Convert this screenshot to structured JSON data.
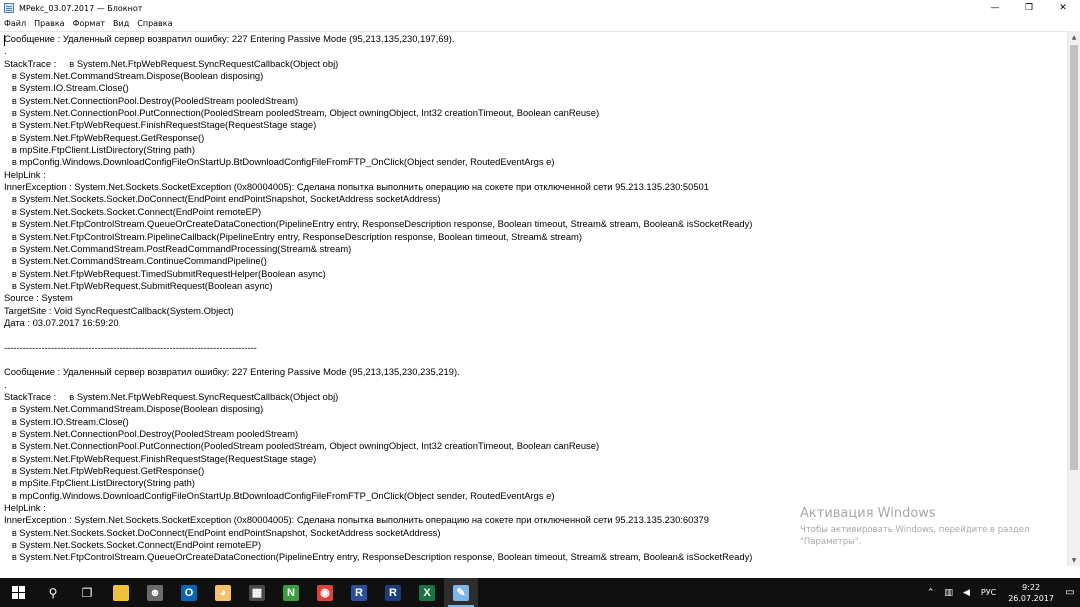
{
  "window": {
    "title": "MPekc_03.07.2017 — Блокнот",
    "minimize_glyph": "—",
    "maximize_glyph": "❐",
    "close_glyph": "✕"
  },
  "menu": {
    "items": [
      "Файл",
      "Правка",
      "Формат",
      "Вид",
      "Справка"
    ]
  },
  "document": {
    "lines": [
      "Сообщение : Удаленный сервер возвратил ошибку: 227 Entering Passive Mode (95,213,135,230,197,69).",
      ".",
      "StackTrace :     в System.Net.FtpWebRequest.SyncRequestCallback(Object obj)",
      "   в System.Net.CommandStream.Dispose(Boolean disposing)",
      "   в System.IO.Stream.Close()",
      "   в System.Net.ConnectionPool.Destroy(PooledStream pooledStream)",
      "   в System.Net.ConnectionPool.PutConnection(PooledStream pooledStream, Object owningObject, Int32 creationTimeout, Boolean canReuse)",
      "   в System.Net.FtpWebRequest.FinishRequestStage(RequestStage stage)",
      "   в System.Net.FtpWebRequest.GetResponse()",
      "   в mpSite.FtpClient.ListDirectory(String path)",
      "   в mpConfig.Windows.DownloadConfigFileOnStartUp.BtDownloadConfigFileFromFTP_OnClick(Object sender, RoutedEventArgs e)",
      "HelpLink :",
      "InnerException : System.Net.Sockets.SocketException (0x80004005): Сделана попытка выполнить операцию на сокете при отключенной сети 95.213.135.230:50501",
      "   в System.Net.Sockets.Socket.DoConnect(EndPoint endPointSnapshot, SocketAddress socketAddress)",
      "   в System.Net.Sockets.Socket.Connect(EndPoint remoteEP)",
      "   в System.Net.FtpControlStream.QueueOrCreateDataConection(PipelineEntry entry, ResponseDescription response, Boolean timeout, Stream& stream, Boolean& isSocketReady)",
      "   в System.Net.FtpControlStream.PipelineCallback(PipelineEntry entry, ResponseDescription response, Boolean timeout, Stream& stream)",
      "   в System.Net.CommandStream.PostReadCommandProcessing(Stream& stream)",
      "   в System.Net.CommandStream.ContinueCommandPipeline()",
      "   в System.Net.FtpWebRequest.TimedSubmitRequestHelper(Boolean async)",
      "   в System.Net.FtpWebRequest.SubmitRequest(Boolean async)",
      "Source : System",
      "TargetSite : Void SyncRequestCallback(System.Object)",
      "Дата : 03.07.2017 16:59:20",
      "",
      "---------------------------------------------------------------------------------",
      "",
      "Сообщение : Удаленный сервер возвратил ошибку: 227 Entering Passive Mode (95,213,135,230,235,219).",
      ".",
      "StackTrace :     в System.Net.FtpWebRequest.SyncRequestCallback(Object obj)",
      "   в System.Net.CommandStream.Dispose(Boolean disposing)",
      "   в System.IO.Stream.Close()",
      "   в System.Net.ConnectionPool.Destroy(PooledStream pooledStream)",
      "   в System.Net.ConnectionPool.PutConnection(PooledStream pooledStream, Object owningObject, Int32 creationTimeout, Boolean canReuse)",
      "   в System.Net.FtpWebRequest.FinishRequestStage(RequestStage stage)",
      "   в System.Net.FtpWebRequest.GetResponse()",
      "   в mpSite.FtpClient.ListDirectory(String path)",
      "   в mpConfig.Windows.DownloadConfigFileOnStartUp.BtDownloadConfigFileFromFTP_OnClick(Object sender, RoutedEventArgs e)",
      "HelpLink :",
      "InnerException : System.Net.Sockets.SocketException (0x80004005): Сделана попытка выполнить операцию на сокете при отключенной сети 95.213.135.230:60379",
      "   в System.Net.Sockets.Socket.DoConnect(EndPoint endPointSnapshot, SocketAddress socketAddress)",
      "   в System.Net.Sockets.Socket.Connect(EndPoint remoteEP)",
      "   в System.Net.FtpControlStream.QueueOrCreateDataConection(PipelineEntry entry, ResponseDescription response, Boolean timeout, Stream& stream, Boolean& isSocketReady)"
    ]
  },
  "scrollbar": {
    "up_glyph": "▲",
    "down_glyph": "▼"
  },
  "activation_watermark": {
    "title": "Активация Windows",
    "line1": "Чтобы активировать Windows, перейдите в раздел",
    "line2": "\"Параметры\"."
  },
  "taskbar": {
    "search_glyph": "⚲",
    "task_view_glyph": "❐",
    "apps": [
      {
        "name": "file-explorer-icon",
        "glyph": "",
        "color": "#f0c23b"
      },
      {
        "name": "people-icon",
        "glyph": "☻",
        "color": "#6b6b6b"
      },
      {
        "name": "outlook-icon",
        "glyph": "O",
        "color": "#0a64b4"
      },
      {
        "name": "paint-icon",
        "glyph": "◕",
        "color": "#f5c26b"
      },
      {
        "name": "calculator-icon",
        "glyph": "▦",
        "color": "#4b4b4b"
      },
      {
        "name": "notepad-plus-icon",
        "glyph": "N",
        "color": "#3f9b3f"
      },
      {
        "name": "chrome-icon",
        "glyph": "◉",
        "color": "#db4437"
      },
      {
        "name": "app-r-icon",
        "glyph": "R",
        "color": "#2a4f9e"
      },
      {
        "name": "app-r2-icon",
        "glyph": "R",
        "color": "#1d3d7a"
      },
      {
        "name": "excel-icon",
        "glyph": "X",
        "color": "#1e7145"
      },
      {
        "name": "notepad-icon",
        "glyph": "✎",
        "color": "#7fb6e6"
      }
    ],
    "tray": {
      "chevron_glyph": "⌃",
      "network_glyph": "▥",
      "volume_glyph": "◀",
      "language": "РУС",
      "time": "9:22",
      "date": "26.07.2017",
      "notification_glyph": "▭"
    }
  }
}
